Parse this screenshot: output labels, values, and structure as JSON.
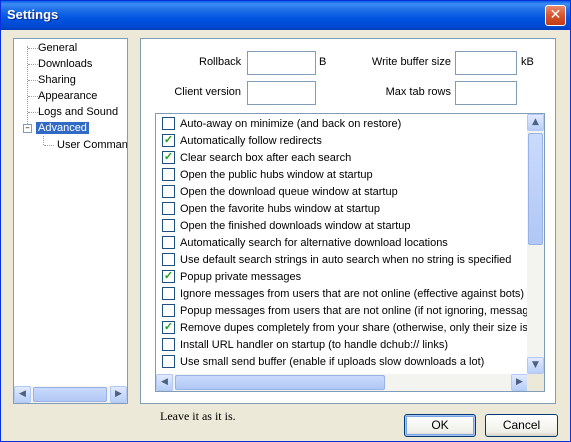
{
  "window": {
    "title": "Settings"
  },
  "tree": {
    "items": [
      {
        "label": "General"
      },
      {
        "label": "Downloads"
      },
      {
        "label": "Sharing"
      },
      {
        "label": "Appearance"
      },
      {
        "label": "Logs and Sound"
      },
      {
        "label": "Advanced",
        "selected": true
      },
      {
        "label": "User Commands"
      }
    ]
  },
  "fields": {
    "rollback": {
      "label": "Rollback",
      "value": "",
      "unit": "B"
    },
    "write_buffer": {
      "label": "Write buffer size",
      "value": "",
      "unit": "kB"
    },
    "client_version": {
      "label": "Client version",
      "value": ""
    },
    "max_tab_rows": {
      "label": "Max tab rows",
      "value": ""
    }
  },
  "options": [
    {
      "label": "Auto-away on minimize (and back on restore)",
      "checked": false
    },
    {
      "label": "Automatically follow redirects",
      "checked": true
    },
    {
      "label": "Clear search box after each search",
      "checked": true
    },
    {
      "label": "Open the public hubs window at startup",
      "checked": false
    },
    {
      "label": "Open the download queue window at startup",
      "checked": false
    },
    {
      "label": "Open the favorite hubs window at startup",
      "checked": false
    },
    {
      "label": "Open the finished downloads window at startup",
      "checked": false
    },
    {
      "label": "Automatically search for alternative download locations",
      "checked": false
    },
    {
      "label": "Use default search strings in auto search when no string is specified",
      "checked": false
    },
    {
      "label": "Popup private messages",
      "checked": true
    },
    {
      "label": "Ignore messages from users that are not online (effective against bots)",
      "checked": false
    },
    {
      "label": "Popup messages from users that are not online (if not ignoring, messages",
      "checked": false
    },
    {
      "label": "Remove dupes completely from your share (otherwise, only their size is sul",
      "checked": true
    },
    {
      "label": "Install URL handler on startup (to handle dchub:// links)",
      "checked": false
    },
    {
      "label": "Use small send buffer (enable if uploads slow downloads a lot)",
      "checked": false
    }
  ],
  "status": {
    "text": "Leave it as it is."
  },
  "buttons": {
    "ok": "OK",
    "cancel": "Cancel"
  },
  "icons": {
    "close": "close-icon",
    "expander": "minus-icon",
    "arrow_left": "arrow-left-icon",
    "arrow_right": "arrow-right-icon",
    "arrow_up": "arrow-up-icon",
    "arrow_down": "arrow-down-icon"
  },
  "colors": {
    "titlebar": "#0054e3",
    "selection": "#316ac5",
    "check": "#21a121",
    "window_bg": "#ece9d8"
  }
}
